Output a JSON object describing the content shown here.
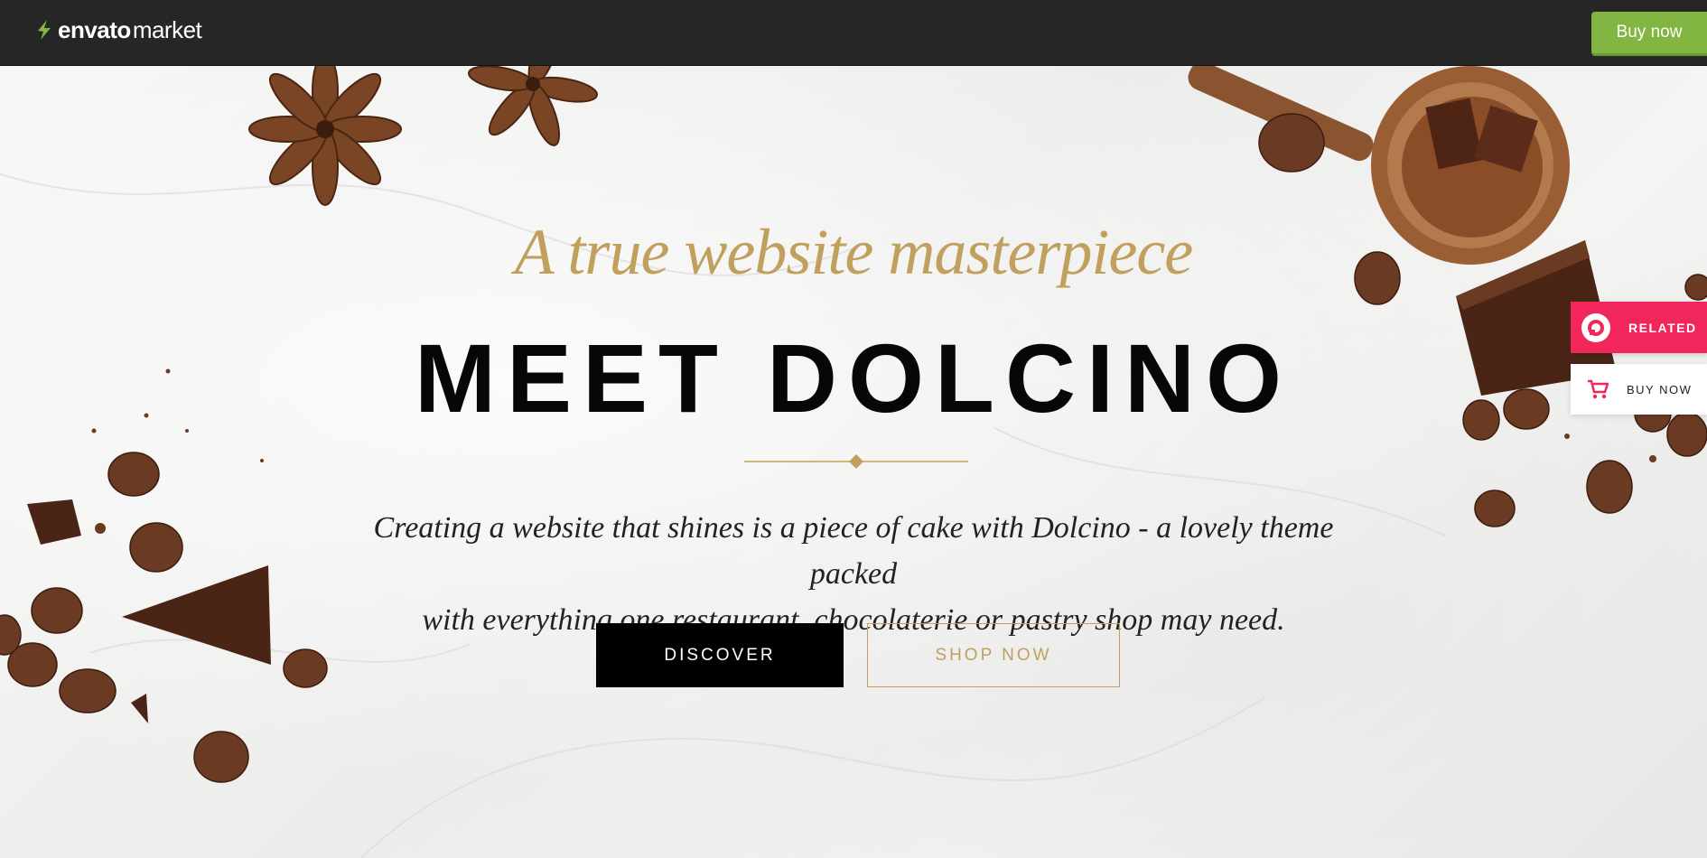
{
  "topbar": {
    "brand": "envato",
    "brand_suffix": "market",
    "buy_now_label": "Buy now",
    "accent_color": "#82b541"
  },
  "hero": {
    "script_title": "A true website masterpiece",
    "main_title": "MEET DOLCINO",
    "tagline_line1": "Creating a website that shines is a piece of cake with Dolcino - a lovely theme packed",
    "tagline_line2": "with everything one restaurant, chocolaterie or pastry shop may need.",
    "discover_label": "DISCOVER",
    "shop_now_label": "SHOP NOW",
    "gold_color": "#c1a05d"
  },
  "side_widget": {
    "related_label": "RELATED",
    "buy_now_label": "BUY NOW",
    "related_color": "#f1275c"
  }
}
